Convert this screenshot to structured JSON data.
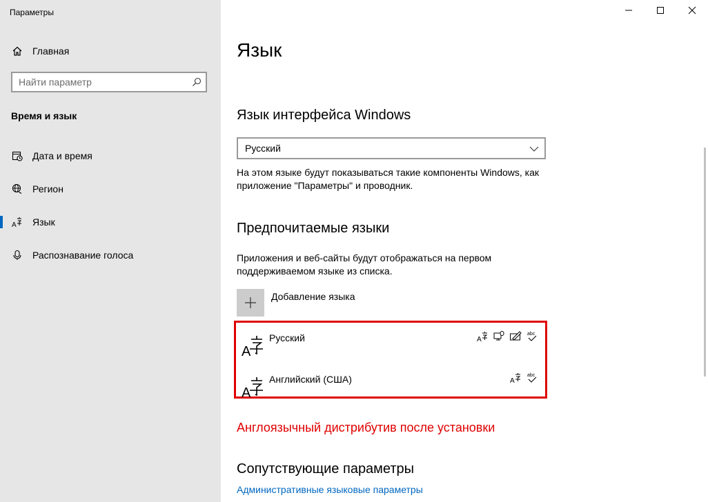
{
  "window": {
    "title": "Параметры",
    "controls": [
      "minimize-icon",
      "maximize-icon",
      "close-icon"
    ]
  },
  "sidebar": {
    "home_label": "Главная",
    "search_placeholder": "Найти параметр",
    "section_title": "Время и язык",
    "items": [
      {
        "label": "Дата и время",
        "icon": "calendar-clock-icon"
      },
      {
        "label": "Регион",
        "icon": "globe-icon"
      },
      {
        "label": "Язык",
        "icon": "language-icon",
        "selected": true
      },
      {
        "label": "Распознавание голоса",
        "icon": "microphone-icon"
      }
    ]
  },
  "main": {
    "title": "Язык",
    "display_language": {
      "heading": "Язык интерфейса Windows",
      "selected": "Русский",
      "description_line1": "На этом языке будут показываться такие компоненты Windows, как",
      "description_line2": "приложение \"Параметры\" и проводник."
    },
    "preferred": {
      "heading": "Предпочитаемые языки",
      "description_line1": "Приложения и веб-сайты будут отображаться на первом",
      "description_line2": "поддерживаемом языке из списка.",
      "add_label": "Добавление языка",
      "languages": [
        {
          "name": "Русский",
          "features": [
            "display-language-icon",
            "speech-icon",
            "handwriting-icon",
            "spellcheck-icon"
          ]
        },
        {
          "name": "Английский (США)",
          "features": [
            "display-language-icon",
            "spellcheck-icon"
          ]
        }
      ]
    },
    "annotation": "Англоязычный дистрибутив после установки",
    "related": {
      "heading": "Сопутствующие параметры",
      "link": "Административные языковые параметры"
    }
  },
  "colors": {
    "accent": "#0067c0",
    "annotation_red": "#e00000",
    "sidebar_bg": "#e6e6e6"
  }
}
